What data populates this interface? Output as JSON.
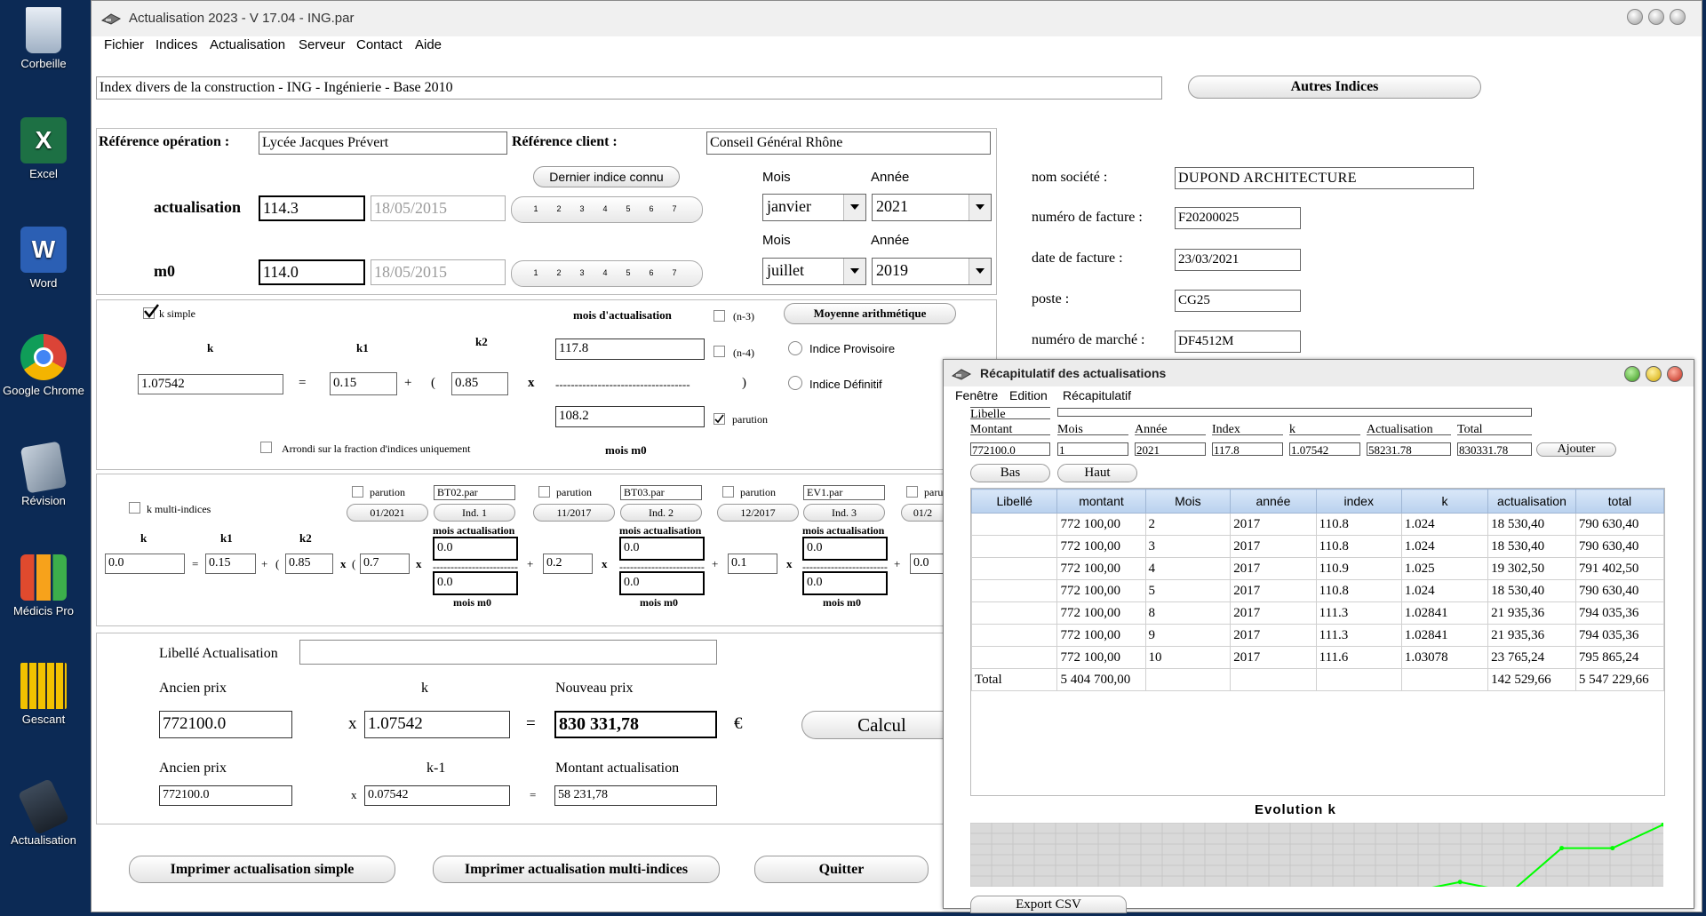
{
  "desktop": {
    "icons": [
      {
        "label": "Corbeille"
      },
      {
        "label": "Excel"
      },
      {
        "label": "Word"
      },
      {
        "label": "Google Chrome"
      },
      {
        "label": "Révision"
      },
      {
        "label": "Médicis Pro"
      },
      {
        "label": "Gescant"
      },
      {
        "label": "Actualisation"
      }
    ]
  },
  "window": {
    "title": "Actualisation 2023 - V 17.04 - ING.par",
    "menu": [
      "Fichier",
      "Indices",
      "Actualisation",
      "Serveur",
      "Contact",
      "Aide"
    ]
  },
  "index_title": "Index divers de la construction - ING - Ingénierie - Base 2010",
  "autres_indices": "Autres Indices",
  "ref": {
    "op_label": "Référence opération :",
    "op_value": "Lycée Jacques Prévert",
    "client_label": "Référence client :",
    "client_value": "Conseil Général Rhône"
  },
  "dernier_indice": "Dernier indice connu",
  "labels": {
    "mois": "Mois",
    "annee": "Année",
    "actualisation": "actualisation",
    "m0": "m0"
  },
  "pages": [
    "1",
    "2",
    "3",
    "4",
    "5",
    "6",
    "7"
  ],
  "actualisation": {
    "index": "114.3",
    "date": "18/05/2015",
    "mois": "janvier",
    "annee": "2021"
  },
  "m0": {
    "index": "114.0",
    "date": "18/05/2015",
    "mois": "juillet",
    "annee": "2019"
  },
  "company": {
    "nom_label": "nom société :",
    "nom": "DUPOND ARCHITECTURE",
    "facture_label": "numéro de facture :",
    "facture": "F20200025",
    "date_label": "date de facture :",
    "date": "23/03/2021",
    "poste_label": "poste :",
    "poste": "CG25",
    "marche_label": "numéro de marché :",
    "marche": "DF4512M"
  },
  "ksimple": {
    "label": "k simple",
    "mois_actu_label": "mois d'actualisation",
    "n3": "(n-3)",
    "n4": "(n-4)",
    "moyenne": "Moyenne arithmétique",
    "k_label": "k",
    "k1_label": "k1",
    "k2_label": "k2",
    "k": "1.07542",
    "k1": "0.15",
    "k2": "0.85",
    "actu_value": "117.8",
    "m0_value": "108.2",
    "eq": "=",
    "plus": "+",
    "paren_open": "(",
    "paren_close": ")",
    "times": "x",
    "dashes": "-----------------------------------",
    "provisoire": "Indice Provisoire",
    "definitif": "Indice Définitif",
    "parution": "parution",
    "arrondi": "Arrondi sur la fraction d'indices uniquement",
    "mois_m0": "mois m0"
  },
  "kmulti": {
    "label": "k multi-indices",
    "k": "0.0",
    "k1": "0.15",
    "k2": "0.85",
    "groups": [
      {
        "parution": "parution",
        "file": "BT02.par",
        "date": "01/2021",
        "ind": "Ind. 1",
        "coef": "0.7",
        "top": "0.0",
        "bottom": "0.0"
      },
      {
        "parution": "parution",
        "file": "BT03.par",
        "date": "11/2017",
        "ind": "Ind. 2",
        "coef": "0.2",
        "top": "0.0",
        "bottom": "0.0"
      },
      {
        "parution": "parution",
        "file": "EV1.par",
        "date": "12/2017",
        "ind": "Ind. 3",
        "coef": "0.1",
        "top": "0.0",
        "bottom": "0.0"
      },
      {
        "parution": "paru",
        "file": "",
        "date": "01/2",
        "ind": "",
        "coef": "0.0",
        "top": "",
        "bottom": ""
      }
    ],
    "mois_actu": "mois actualisation",
    "mois_m0": "mois m0",
    "dashes": "-------------------------"
  },
  "calc": {
    "libelle_label": "Libellé Actualisation",
    "libelle": "",
    "ancien_label": "Ancien prix",
    "k_label": "k",
    "nouveau_label": "Nouveau prix",
    "ancien": "772100.0",
    "k": "1.07542",
    "nouveau": "830 331,78",
    "euro": "€",
    "calcul": "Calcul",
    "ancien2_label": "Ancien prix",
    "km1_label": "k-1",
    "montant_label": "Montant actualisation",
    "ancien2": "772100.0",
    "km1": "0.07542",
    "montant": "58 231,78",
    "times": "x",
    "eq": "="
  },
  "bottom": {
    "print_simple": "Imprimer actualisation simple",
    "print_multi": "Imprimer actualisation multi-indices",
    "quit": "Quitter"
  },
  "recap": {
    "title": "Récapitulatif des actualisations",
    "menu": [
      "Fenêtre",
      "Edition",
      "Récapitulatif"
    ],
    "form": {
      "libelle_label": "Libelle",
      "montant_label": "Montant",
      "mois_label": "Mois",
      "annee_label": "Année",
      "index_label": "Index",
      "k_label": "k",
      "actu_label": "Actualisation",
      "total_label": "Total",
      "montant": "772100.0",
      "mois": "1",
      "annee": "2021",
      "index": "117.8",
      "k": "1.07542",
      "actu": "58231.78",
      "total": "830331.78",
      "ajouter": "Ajouter"
    },
    "bas": "Bas",
    "haut": "Haut",
    "columns": [
      "Libellé",
      "montant",
      "Mois",
      "année",
      "index",
      "k",
      "actualisation",
      "total"
    ],
    "rows": [
      [
        "",
        "772 100,00",
        "2",
        "2017",
        "110.8",
        "1.024",
        "18 530,40",
        "790 630,40"
      ],
      [
        "",
        "772 100,00",
        "3",
        "2017",
        "110.8",
        "1.024",
        "18 530,40",
        "790 630,40"
      ],
      [
        "",
        "772 100,00",
        "4",
        "2017",
        "110.9",
        "1.025",
        "19 302,50",
        "791 402,50"
      ],
      [
        "",
        "772 100,00",
        "5",
        "2017",
        "110.8",
        "1.024",
        "18 530,40",
        "790 630,40"
      ],
      [
        "",
        "772 100,00",
        "8",
        "2017",
        "111.3",
        "1.02841",
        "21 935,36",
        "794 035,36"
      ],
      [
        "",
        "772 100,00",
        "9",
        "2017",
        "111.3",
        "1.02841",
        "21 935,36",
        "794 035,36"
      ],
      [
        "",
        "772 100,00",
        "10",
        "2017",
        "111.6",
        "1.03078",
        "23 765,24",
        "795 865,24"
      ],
      [
        "Total",
        "5 404 700,00",
        "",
        "",
        "",
        "",
        "142 529,66",
        "5 547 229,66"
      ]
    ],
    "chart_title": "Evolution k",
    "export": "Export CSV"
  },
  "chart_data": {
    "type": "line",
    "title": "Evolution k",
    "series": [
      {
        "values": [
          1.024,
          1.024,
          1.025,
          1.024,
          1.02841,
          1.02841,
          1.03078
        ]
      }
    ],
    "line_color": "#00ff00",
    "grid": true
  }
}
